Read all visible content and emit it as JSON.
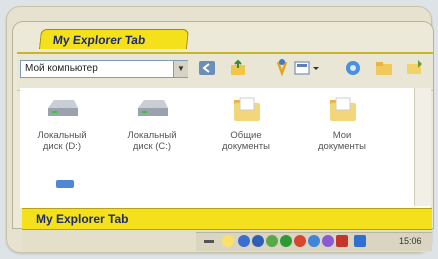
{
  "window": {
    "tab_title": "My Explorer Tab",
    "bottom_tab_title": "My Explorer Tab"
  },
  "toolbar": {
    "address_value": "Мой компьютер",
    "icons": [
      "back-icon",
      "up-folder-icon",
      "folder-star-icon",
      "view-menu-icon",
      "sync-icon",
      "folder-icon",
      "arrow-icon"
    ]
  },
  "items": [
    {
      "label_line1": "Локальный",
      "label_line2": "диск (D:)",
      "icon": "hard-drive-icon"
    },
    {
      "label_line1": "Локальный",
      "label_line2": "диск (C:)",
      "icon": "hard-drive-icon"
    },
    {
      "label_line1": "Общие",
      "label_line2": "документы",
      "icon": "folder-icon"
    },
    {
      "label_line1": "Мои",
      "label_line2": "документы",
      "icon": "folder-icon"
    }
  ],
  "taskbar": {
    "clock": "15:06",
    "colors": {
      "accent_yellow": "#f4e11c",
      "tab_text": "#1d2a78"
    }
  }
}
